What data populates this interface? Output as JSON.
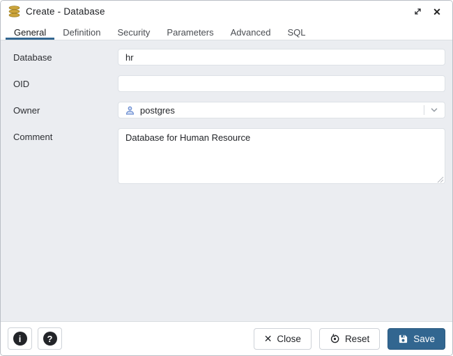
{
  "window": {
    "title": "Create - Database"
  },
  "tabs": [
    {
      "label": "General",
      "active": true
    },
    {
      "label": "Definition",
      "active": false
    },
    {
      "label": "Security",
      "active": false
    },
    {
      "label": "Parameters",
      "active": false
    },
    {
      "label": "Advanced",
      "active": false
    },
    {
      "label": "SQL",
      "active": false
    }
  ],
  "form": {
    "database": {
      "label": "Database",
      "value": "hr"
    },
    "oid": {
      "label": "OID",
      "value": ""
    },
    "owner": {
      "label": "Owner",
      "value": "postgres"
    },
    "comment": {
      "label": "Comment",
      "value": "Database for Human Resource"
    }
  },
  "footer": {
    "info_glyph": "i",
    "help_glyph": "?",
    "close_glyph": "✕",
    "close_label": "Close",
    "reset_label": "Reset",
    "save_label": "Save"
  },
  "titlebar_icons": {
    "close_glyph": "✕"
  },
  "colors": {
    "accent_blue": "#326690",
    "content_bg": "#ebedf1",
    "db_icon_gold": "#cda53c",
    "owner_icon_blue": "#5f83cd",
    "icon_circle_black": "#222428"
  }
}
